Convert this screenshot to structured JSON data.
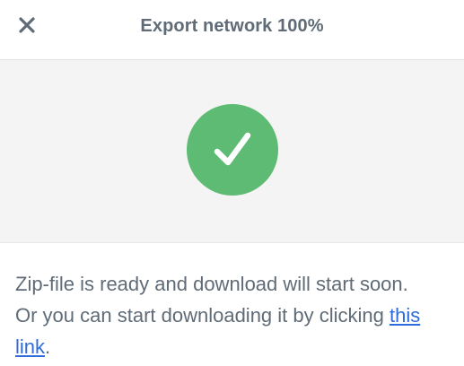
{
  "dialog": {
    "title": "Export network 100%",
    "close_icon": "close-icon",
    "status_icon": "checkmark-icon",
    "status_color": "#5ebb73",
    "message_line1": "Zip-file is ready and download will start soon.",
    "message_line2": "Or you can start downloading it by clicking",
    "link_text": "this link",
    "message_end": ".",
    "link_color": "#2e6bdc",
    "progress_percent": 100
  }
}
